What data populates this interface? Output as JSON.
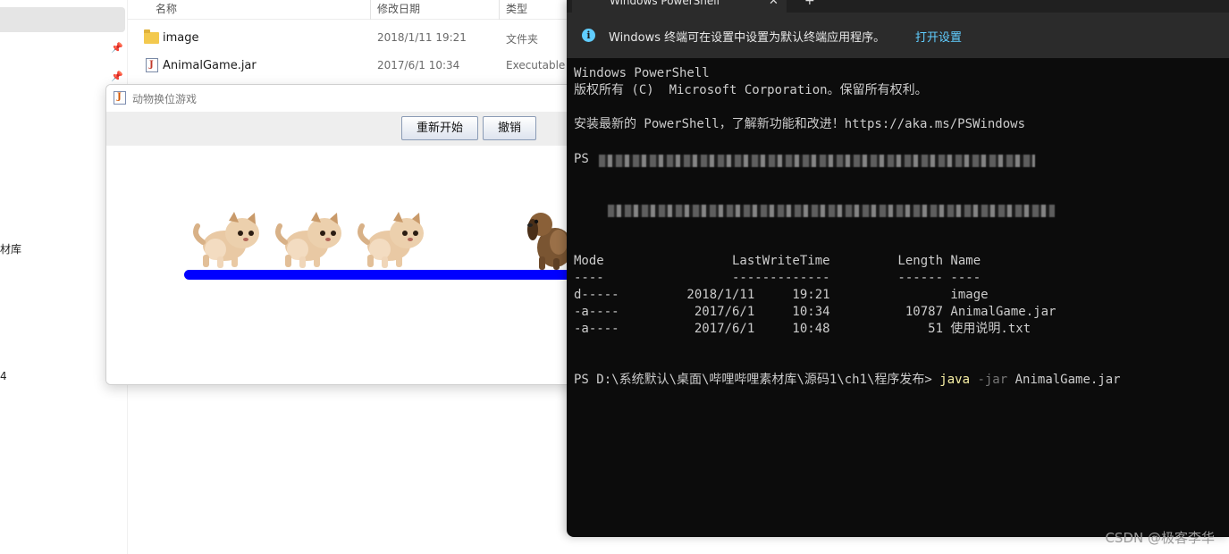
{
  "explorer": {
    "columns": {
      "name": "名称",
      "date": "修改日期",
      "type": "类型"
    },
    "files": [
      {
        "name": "image",
        "date": "2018/1/11 19:21",
        "type": "文件夹",
        "icon": "folder-icon"
      },
      {
        "name": "AnimalGame.jar",
        "date": "2017/6/1 10:34",
        "type": "Executable",
        "icon": "jar-file-icon"
      }
    ],
    "sidebar_fragments": [
      "材库",
      "4"
    ]
  },
  "game": {
    "title": "动物换位游戏",
    "restart_label": "重新开始",
    "undo_label": "撤销",
    "track_color": "#0000ff",
    "animals": [
      "cat",
      "cat",
      "cat",
      "dog"
    ]
  },
  "terminal": {
    "tab_title": "Windows PowerShell",
    "tab_close": "✕",
    "tab_add": "+",
    "banner_message": "Windows 终端可在设置中设置为默认终端应用程序。",
    "banner_link": "打开设置",
    "lines": {
      "l1": "Windows PowerShell",
      "l2": "版权所有 (C)  Microsoft Corporation。保留所有权利。",
      "l3": "安装最新的 PowerShell，了解新功能和改进！https://aka.ms/PSWindows",
      "l4_prefix": "PS",
      "header": "Mode                 LastWriteTime         Length Name",
      "underline": "----                 -------------         ------ ----",
      "row1": "d-----         2018/1/11     19:21                image",
      "row2": "-a----          2017/6/1     10:34          10787 AnimalGame.jar",
      "row3": "-a----          2017/6/1     10:48             51 使用说明.txt"
    },
    "prompt": "PS D:\\系统默认\\桌面\\哔哩哔哩素材库\\源码1\\ch1\\程序发布> ",
    "cmd_java": "java",
    "cmd_flag": " -jar",
    "cmd_arg": " AnimalGame.jar",
    "accent_color": "#60cdff"
  },
  "watermark": "CSDN @极客李华"
}
